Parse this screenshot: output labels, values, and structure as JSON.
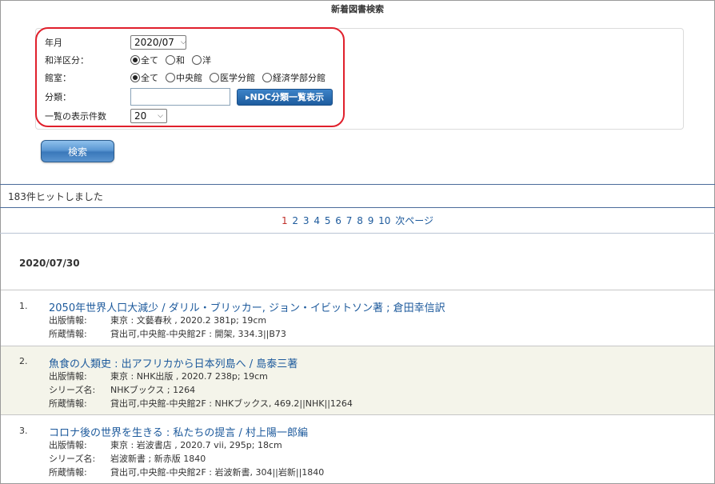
{
  "page": {
    "title": "新着図書検索"
  },
  "form": {
    "year_month": {
      "label": "年月",
      "value": "2020/07"
    },
    "wayo": {
      "label": "和洋区分：",
      "options": [
        {
          "label": "全て",
          "selected": true
        },
        {
          "label": "和",
          "selected": false
        },
        {
          "label": "洋",
          "selected": false
        }
      ]
    },
    "library": {
      "label": "館室：",
      "options": [
        {
          "label": "全て",
          "selected": true
        },
        {
          "label": "中央館",
          "selected": false
        },
        {
          "label": "医学分館",
          "selected": false
        },
        {
          "label": "経済学部分館",
          "selected": false
        }
      ]
    },
    "classification": {
      "label": "分類：",
      "value": "",
      "ndc_button": "▸NDC分類一覧表示"
    },
    "per_page": {
      "label": "一覧の表示件数",
      "value": "20"
    },
    "search_button": "検索"
  },
  "results": {
    "hit_text": "183件ヒットしました",
    "pager": {
      "current": "1",
      "pages": [
        "2",
        "3",
        "4",
        "5",
        "6",
        "7",
        "8",
        "9",
        "10"
      ],
      "next": "次ページ"
    },
    "date_heading": "2020/07/30",
    "records": [
      {
        "num": "1.",
        "title": "2050年世界人口大減少 / ダリル・ブリッカー, ジョン・イビットソン著 ; 倉田幸信訳",
        "pub_label": "出版情報:",
        "pub": "東京 : 文藝春秋 , 2020.2 381p; 19cm",
        "holding_label": "所蔵情報:",
        "holding": "貸出可,中央館-中央館2F : 開架, 334.3||B73"
      },
      {
        "num": "2.",
        "title": "魚食の人類史 : 出アフリカから日本列島へ / 島泰三著",
        "pub_label": "出版情報:",
        "pub": "東京 : NHK出版 , 2020.7 238p; 19cm",
        "series_label": "シリーズ名:",
        "series": "NHKブックス ; 1264",
        "holding_label": "所蔵情報:",
        "holding": "貸出可,中央館-中央館2F : NHKブックス, 469.2||NHK||1264"
      },
      {
        "num": "3.",
        "title": "コロナ後の世界を生きる : 私たちの提言 / 村上陽一郎編",
        "pub_label": "出版情報:",
        "pub": "東京 : 岩波書店 , 2020.7 vii, 295p; 18cm",
        "series_label": "シリーズ名:",
        "series": "岩波新書 ; 新赤版 1840",
        "holding_label": "所蔵情報:",
        "holding": "貸出可,中央館-中央館2F : 岩波新書, 304||岩新||1840"
      }
    ]
  },
  "colors": {
    "link": "#1d5a9c",
    "current_page": "#c0302a",
    "highlight": "#e0202c",
    "alt_row": "#f4f4ea"
  }
}
